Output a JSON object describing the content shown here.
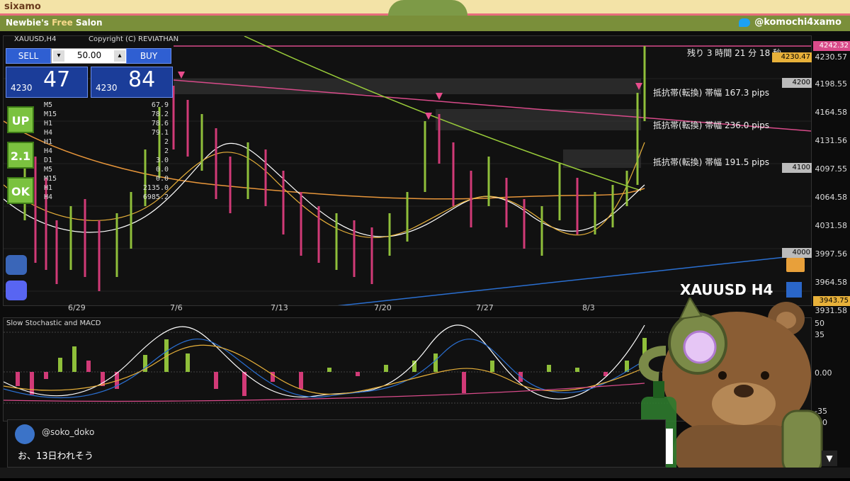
{
  "header": {
    "brand": "sixamo",
    "subtitle_prefix": "Newbie's ",
    "subtitle_highlight": "Free",
    "subtitle_suffix": " Salon",
    "twitter_handle": "@komochi4xamo"
  },
  "chart": {
    "symbol_label": "XAUUSD,H4",
    "copyright": "Copyright (C) REVIATHAN",
    "countdown": "残り 3 時間 21 分 18 秒",
    "watermark": "XAUUSD H4",
    "indicator_title": "Slow Stochastic and MACD",
    "colors": {
      "accent": "#d94b8a",
      "bull": "#8fbf3a",
      "bear": "#d13a77",
      "blue": "#2a6fd1",
      "yellow": "#e8b13a"
    }
  },
  "trade_panel": {
    "sell_label": "SELL",
    "buy_label": "BUY",
    "lot_value": "50.00",
    "lot_down": "▾",
    "lot_up": "▴",
    "sell_prefix": "4230",
    "sell_pips": "47",
    "buy_prefix": "4230",
    "buy_pips": "84"
  },
  "left_indicators": {
    "badges": [
      "UP",
      "2.1",
      "OK"
    ],
    "rows": [
      {
        "tf": "M5",
        "value": "67.9"
      },
      {
        "tf": "M15",
        "value": "78.2"
      },
      {
        "tf": "H1",
        "value": "78.6"
      },
      {
        "tf": "H4",
        "value": "79.1"
      },
      {
        "tf": "H1",
        "value": "2"
      },
      {
        "tf": "H4",
        "value": "2"
      },
      {
        "tf": "D1",
        "value": "3.0"
      },
      {
        "tf": "M5",
        "value": "0.0"
      },
      {
        "tf": "M15",
        "value": "0.0"
      },
      {
        "tf": "H1",
        "value": "2135.0"
      },
      {
        "tf": "H4",
        "value": "6985.2"
      }
    ]
  },
  "price_axis": {
    "levels": [
      "4230.57",
      "4198.55",
      "4164.58",
      "4131.56",
      "4097.55",
      "4064.58",
      "4031.58",
      "3997.56",
      "3964.58",
      "3931.58"
    ],
    "macd_levels": [
      "50",
      "35",
      "0.00",
      "-35",
      "-50"
    ]
  },
  "price_tags": [
    {
      "text": "4242.32",
      "bg": "#d94b8a",
      "fg": "#fff"
    },
    {
      "text": "4230.47",
      "bg": "#e8b13a",
      "fg": "#000"
    },
    {
      "text": "4200",
      "bg": "#bbbbbb",
      "fg": "#000"
    },
    {
      "text": "4100",
      "bg": "#bbbbbb",
      "fg": "#000"
    },
    {
      "text": "4000",
      "bg": "#bbbbbb",
      "fg": "#000"
    },
    {
      "text": "3943.75",
      "bg": "#e8b13a",
      "fg": "#000"
    }
  ],
  "resistance_labels": [
    {
      "text": "抵抗帯(転換) 帯幅 167.3 pips"
    },
    {
      "text": "抵抗帯(転換) 帯幅 236.0 pips"
    },
    {
      "text": "抵抗帯(転換) 帯幅 191.5 pips"
    }
  ],
  "x_axis": {
    "labels": [
      "6/29",
      "7/6",
      "7/13",
      "7/20",
      "7/27",
      "8/3"
    ]
  },
  "chat": {
    "user": "@soko_doko",
    "message": "お、13日われそう"
  }
}
